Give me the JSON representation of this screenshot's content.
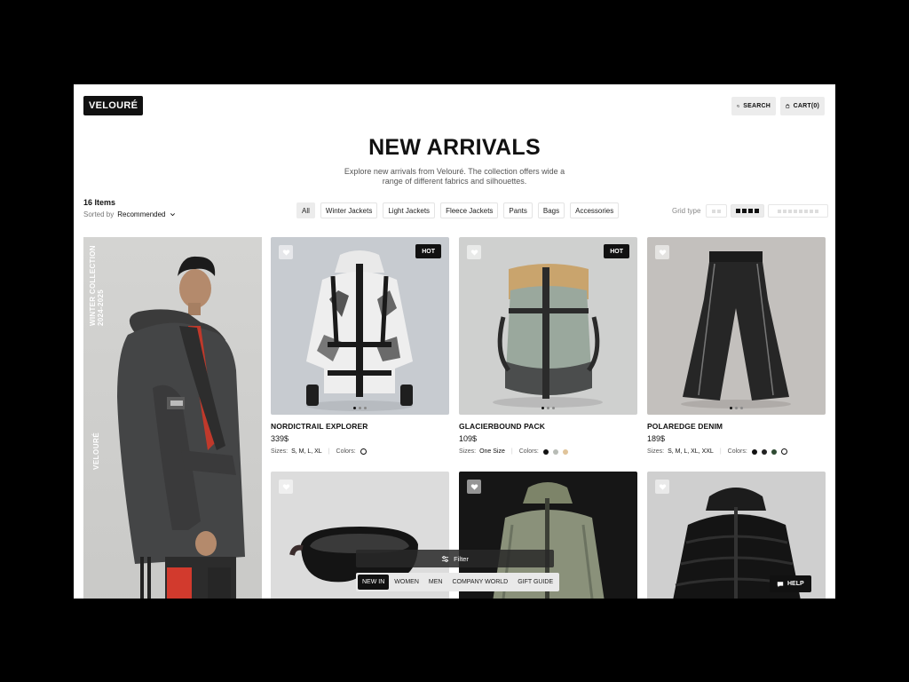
{
  "header": {
    "logo": "VELOURÉ",
    "search_label": "SEARCH",
    "cart_label": "CART(0)"
  },
  "hero": {
    "title": "NEW ARRIVALS",
    "subtitle": "Explore new arrivals from Velouré. The collection offers wide a range of different fabrics and silhouettes."
  },
  "toolbar": {
    "count": "16 Items",
    "sorted_label": "Sorted by",
    "sorted_value": "Recommended",
    "filters": [
      "All",
      "Winter Jackets",
      "Light Jackets",
      "Fleece Jackets",
      "Pants",
      "Bags",
      "Accessories"
    ],
    "active_filter": "All",
    "grid_label": "Grid type"
  },
  "feature": {
    "collection_label": "WINTER COLLECTION\n2024-2025",
    "brand_label": "VELOURÉ"
  },
  "products": [
    {
      "name": "NORDICTRAIL EXPLORER",
      "price": "339$",
      "sizes_label": "Sizes:",
      "sizes": "S, M, L, XL",
      "colors_label": "Colors:",
      "colors": [
        "#ffffff"
      ],
      "badge": "HOT"
    },
    {
      "name": "GLACIERBOUND PACK",
      "price": "109$",
      "sizes_label": "Sizes:",
      "sizes": "One Size",
      "colors_label": "Colors:",
      "colors": [
        "#111111",
        "#b8bcb6",
        "#e0c49a"
      ],
      "badge": "HOT"
    },
    {
      "name": "POLAREDGE DENIM",
      "price": "189$",
      "sizes_label": "Sizes:",
      "sizes": "S, M, L, XL, XXL",
      "colors_label": "Colors:",
      "colors": [
        "#111111",
        "#222222",
        "#2f4a33",
        "#ffffff"
      ],
      "badge": ""
    }
  ],
  "bottom": {
    "filter_label": "Filter",
    "nav": [
      "NEW IN",
      "WOMEN",
      "MEN",
      "COMPANY WORLD",
      "GIFT GUIDE"
    ],
    "active_nav": "NEW IN",
    "help_label": "HELP"
  },
  "colors": {
    "accent": "#111111",
    "page_bg": "#ffffff",
    "frame_bg": "#000000"
  }
}
